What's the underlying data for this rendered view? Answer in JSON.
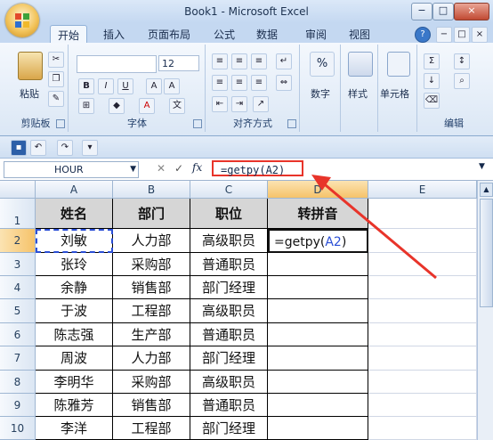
{
  "window": {
    "title": "Book1 - Microsoft Excel",
    "controls": [
      "−",
      "□",
      "×"
    ]
  },
  "ribbon_tabs": [
    {
      "label": "开始",
      "active": true
    },
    {
      "label": "插入"
    },
    {
      "label": "页面布局"
    },
    {
      "label": "公式"
    },
    {
      "label": "数据"
    },
    {
      "label": "审阅"
    },
    {
      "label": "视图"
    }
  ],
  "groups": {
    "clipboard": {
      "label": "剪贴板",
      "paste": "粘贴"
    },
    "font": {
      "label": "字体",
      "size": "12"
    },
    "alignment": {
      "label": "对齐方式"
    },
    "number": {
      "label": "数字",
      "symbol": "%"
    },
    "style": {
      "label": "样式"
    },
    "cells": {
      "label": "单元格"
    },
    "editing": {
      "label": "编辑"
    }
  },
  "formula_bar": {
    "name_box": "HOUR",
    "fx": "fx",
    "formula": "=getpy(A2)"
  },
  "columns": [
    "A",
    "B",
    "C",
    "D",
    "E"
  ],
  "rows": [
    "1",
    "2",
    "3",
    "4",
    "5",
    "6",
    "7",
    "8",
    "9",
    "10"
  ],
  "headers": [
    "姓名",
    "部门",
    "职位",
    "转拼音"
  ],
  "data": [
    [
      "刘敏",
      "人力部",
      "高级职员"
    ],
    [
      "张玲",
      "采购部",
      "普通职员"
    ],
    [
      "余静",
      "销售部",
      "部门经理"
    ],
    [
      "于波",
      "工程部",
      "高级职员"
    ],
    [
      "陈志强",
      "生产部",
      "普通职员"
    ],
    [
      "周波",
      "人力部",
      "部门经理"
    ],
    [
      "李明华",
      "采购部",
      "高级职员"
    ],
    [
      "陈雅芳",
      "销售部",
      "普通职员"
    ],
    [
      "李洋",
      "工程部",
      "部门经理"
    ]
  ],
  "editing_cell": {
    "prefix": "=getpy(",
    "ref": "A2",
    "suffix": ")"
  },
  "colors": {
    "highlight": "#e8342a",
    "ref": "#2b4fd6",
    "header_fill": "#d6d6d6"
  }
}
